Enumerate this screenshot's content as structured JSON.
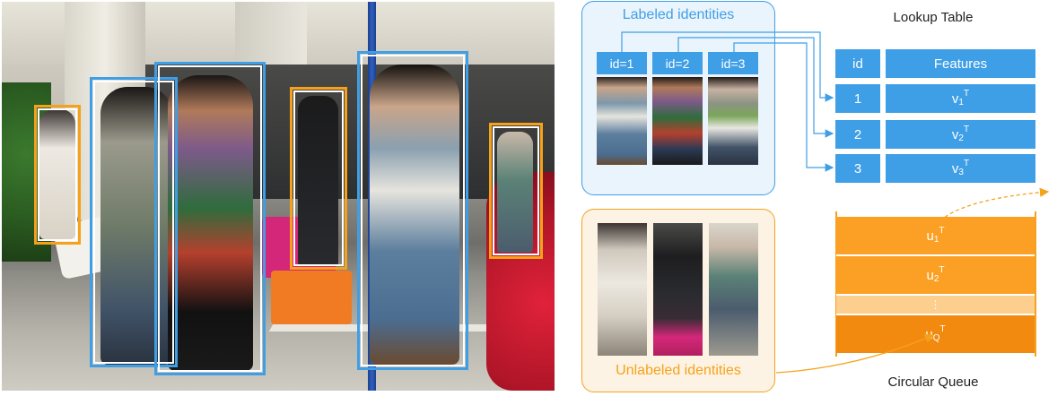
{
  "labeled_panel": {
    "title": "Labeled identities",
    "ids": [
      "id=1",
      "id=2",
      "id=3"
    ]
  },
  "unlabeled_panel": {
    "title": "Unlabeled identities"
  },
  "lookup_table": {
    "title": "Lookup Table",
    "header_id": "id",
    "header_features": "Features",
    "rows": [
      {
        "id": "1",
        "feature_base": "v",
        "feature_sub": "1",
        "feature_sup": "T"
      },
      {
        "id": "2",
        "feature_base": "v",
        "feature_sub": "2",
        "feature_sup": "T"
      },
      {
        "id": "3",
        "feature_base": "v",
        "feature_sub": "3",
        "feature_sup": "T"
      }
    ]
  },
  "circular_queue": {
    "title": "Circular Queue",
    "items": [
      {
        "base": "u",
        "sub": "1",
        "sup": "T"
      },
      {
        "base": "u",
        "sub": "2",
        "sup": "T"
      },
      {
        "base": "u",
        "sub": "Q",
        "sup": "T"
      }
    ],
    "ellipsis": "⋮"
  },
  "colors": {
    "labeled": "#3f9fe6",
    "unlabeled": "#f5a21a",
    "queue_light": "#fba024",
    "queue_dark": "#f28a0f"
  }
}
